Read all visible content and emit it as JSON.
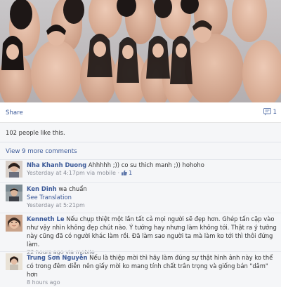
{
  "post": {
    "share_label": "Share",
    "comment_count": "1",
    "likes_text": "102 people like this.",
    "view_more_comments": "View 9 more comments"
  },
  "comments": [
    {
      "author": "Nha Khanh Duong",
      "text": "Ahhhhh ;)) co su thich manh ;)) hohoho",
      "time": "Yesterday at 4:17pm",
      "via": "via mobile",
      "likes": "1"
    },
    {
      "author": "Ken Dinh",
      "text": "wa chuẩn",
      "see_translation": "See Translation",
      "time": "Yesterday at 5:21pm"
    },
    {
      "author": "Kenneth Le",
      "text": "Nếu chụp thiệt một lần tất cả mọi người sẽ đẹp hơn. Ghép tấn cặp vào như vậy nhìn không đẹp chút nào. Ý tưởng hay nhưng làm không tới. Thật ra ý tưởng này cũng đã có người khác làm rồi. Đã làm sao người ta mà làm ko tới thì thôi đứng làm.",
      "time": "22 hours ago",
      "via": "via mobile"
    },
    {
      "author": "Trung Sơn Nguyễn",
      "text": "Nếu là thiệp mời thì hãy làm đúng sự thật hình ảnh này ko thể có trong đêm diễn nên giấy mời ko mang tính chất trân trọng và giống bán \"dâm\" hơn",
      "time": "8 hours ago"
    }
  ],
  "colors": {
    "link": "#3b5998",
    "meta": "#8b8f99",
    "feedback_bg": "#f5f6f8"
  },
  "icons": {
    "comment": "speech-bubble-icon",
    "like": "thumbs-up-icon"
  }
}
